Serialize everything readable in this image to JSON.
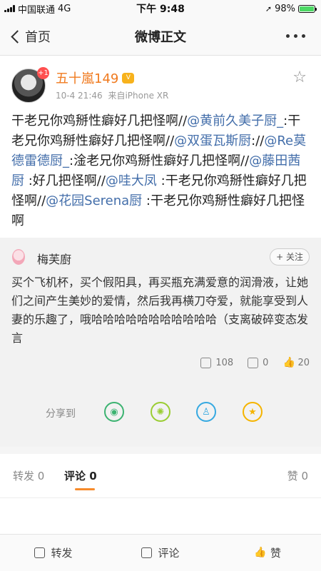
{
  "status_bar": {
    "carrier": "中国联通",
    "network": "4G",
    "time": "下午 9:48",
    "battery_text": "98%",
    "battery_level": 0.98,
    "battery_color": "#4cd964"
  },
  "nav": {
    "back_label": "首页",
    "title": "微博正文",
    "more_icon": "more-icon"
  },
  "post": {
    "avatar_badge": "+1",
    "username": "五十嵐149",
    "vip_badge": "V",
    "date": "10-4 21:46",
    "source": "来自iPhone XR",
    "segments": [
      {
        "text": "干老兄你鸡掰性癖好几把怪啊//",
        "mention": false
      },
      {
        "text": "@黄前久美子厨_",
        "mention": true
      },
      {
        "text": ":干老兄你鸡掰性癖好几把怪啊//",
        "mention": false
      },
      {
        "text": "@双蛋瓦斯厨",
        "mention": true
      },
      {
        "text": "://",
        "mention": false
      },
      {
        "text": "@Re莫德雷德厨_",
        "mention": true
      },
      {
        "text": ":淦老兄你鸡掰性癖好几把怪啊//",
        "mention": false
      },
      {
        "text": "@藤田茜厨",
        "mention": true
      },
      {
        "text": " :好几把怪啊//",
        "mention": false
      },
      {
        "text": "@哇大凤",
        "mention": true
      },
      {
        "text": " :干老兄你鸡掰性癖好几把怪啊//",
        "mention": false
      },
      {
        "text": "@花园Serena厨",
        "mention": true
      },
      {
        "text": " :干老兄你鸡掰性癖好几把怪啊",
        "mention": false
      }
    ]
  },
  "original": {
    "author": "梅芙廚",
    "follow_label": "+ 关注",
    "text": "买个飞机杯，买个假阳具，再买瓶充满爱意的润滑液，让她们之间产生美妙的爱情，然后我再横刀夺爱，就能享受到人妻的乐趣了，哦哈哈哈哈哈哈哈哈哈哈哈（支离破碎变态发言",
    "reposts": "108",
    "comments": "0",
    "likes": "20"
  },
  "share": {
    "label": "分享到",
    "targets": [
      "wechat-icon",
      "moments-icon",
      "qq-icon",
      "qzone-icon"
    ]
  },
  "tabs": {
    "repost": "转发 0",
    "comment": "评论 0",
    "like": "赞 0",
    "accent_color": "#f78b2b"
  },
  "bottom_bar": {
    "repost": "转发",
    "comment": "评论",
    "like": "赞"
  },
  "colors": {
    "mention": "#436eaa",
    "username": "#f07a1e"
  }
}
